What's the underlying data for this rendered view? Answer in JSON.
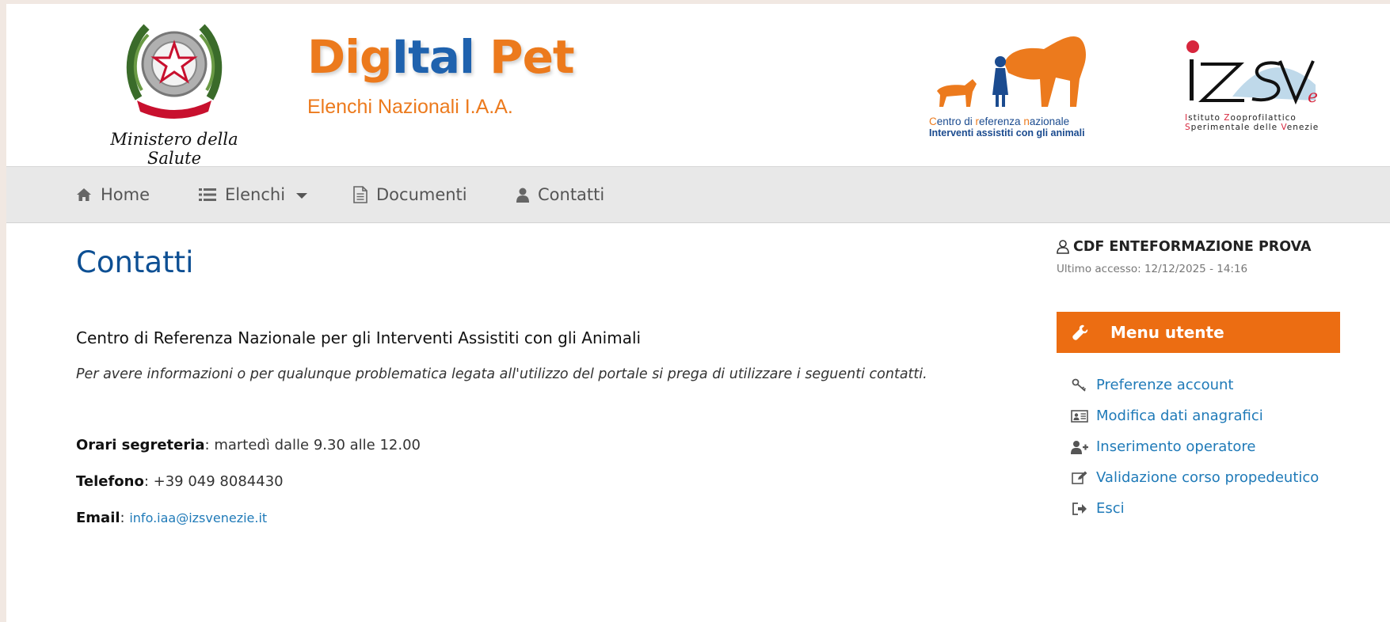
{
  "header": {
    "emblem_caption": "Ministero della Salute",
    "emblem_ribbon": "REPVBBLICA ITALIANA",
    "brand": {
      "part1": "Dig",
      "part2": "Ital",
      "part3": " Pet",
      "subtitle": "Elenchi Nazionali I.A.A."
    },
    "centro_logo": {
      "line1_parts": [
        "C",
        "entro di ",
        "r",
        "eferenza ",
        "n",
        "azionale"
      ],
      "line2": "Interventi assistiti con gli animali"
    },
    "izs_logo": {
      "mark": "IZSVe",
      "line1_parts": [
        "I",
        "stituto ",
        "Z",
        "ooprofilattico"
      ],
      "line2_parts": [
        "S",
        "perimentale delle ",
        "V",
        "enezie"
      ]
    }
  },
  "nav": [
    {
      "label": "Home",
      "icon": "home-icon"
    },
    {
      "label": "Elenchi",
      "icon": "list-icon",
      "dropdown": true
    },
    {
      "label": "Documenti",
      "icon": "document-icon"
    },
    {
      "label": "Contatti",
      "icon": "user-icon"
    }
  ],
  "main": {
    "title": "Contatti",
    "org": "Centro di Referenza Nazionale per gli Interventi Assistiti con gli Animali",
    "intro": "Per avere informazioni o per qualunque problematica legata all'utilizzo del portale si prega di utilizzare i seguenti contatti.",
    "hours_label": "Orari segreteria",
    "hours_value": ": martedì dalle 9.30 alle 12.00",
    "phone_label": "Telefono",
    "phone_value": ": +39 049 8084430",
    "email_label": "Email",
    "email_sep": ": ",
    "email_value": "info.iaa@izsvenezie.it"
  },
  "sidebar": {
    "user_name": "CDF ENTEFORMAZIONE PROVA",
    "last_access": "Ultimo accesso: 12/12/2025 - 14:16",
    "menu_title": "Menu utente",
    "items": [
      {
        "label": "Preferenze account",
        "icon": "key-icon"
      },
      {
        "label": "Modifica dati anagrafici",
        "icon": "id-card-icon"
      },
      {
        "label": "Inserimento operatore",
        "icon": "user-add-icon"
      },
      {
        "label": "Validazione corso propedeutico",
        "icon": "edit-icon"
      },
      {
        "label": "Esci",
        "icon": "sign-out-icon"
      }
    ]
  },
  "colors": {
    "accent_orange": "#ec6d12",
    "brand_blue": "#0d4f93",
    "link_blue": "#1f7ab8",
    "nav_bg": "#e8e8e8"
  }
}
